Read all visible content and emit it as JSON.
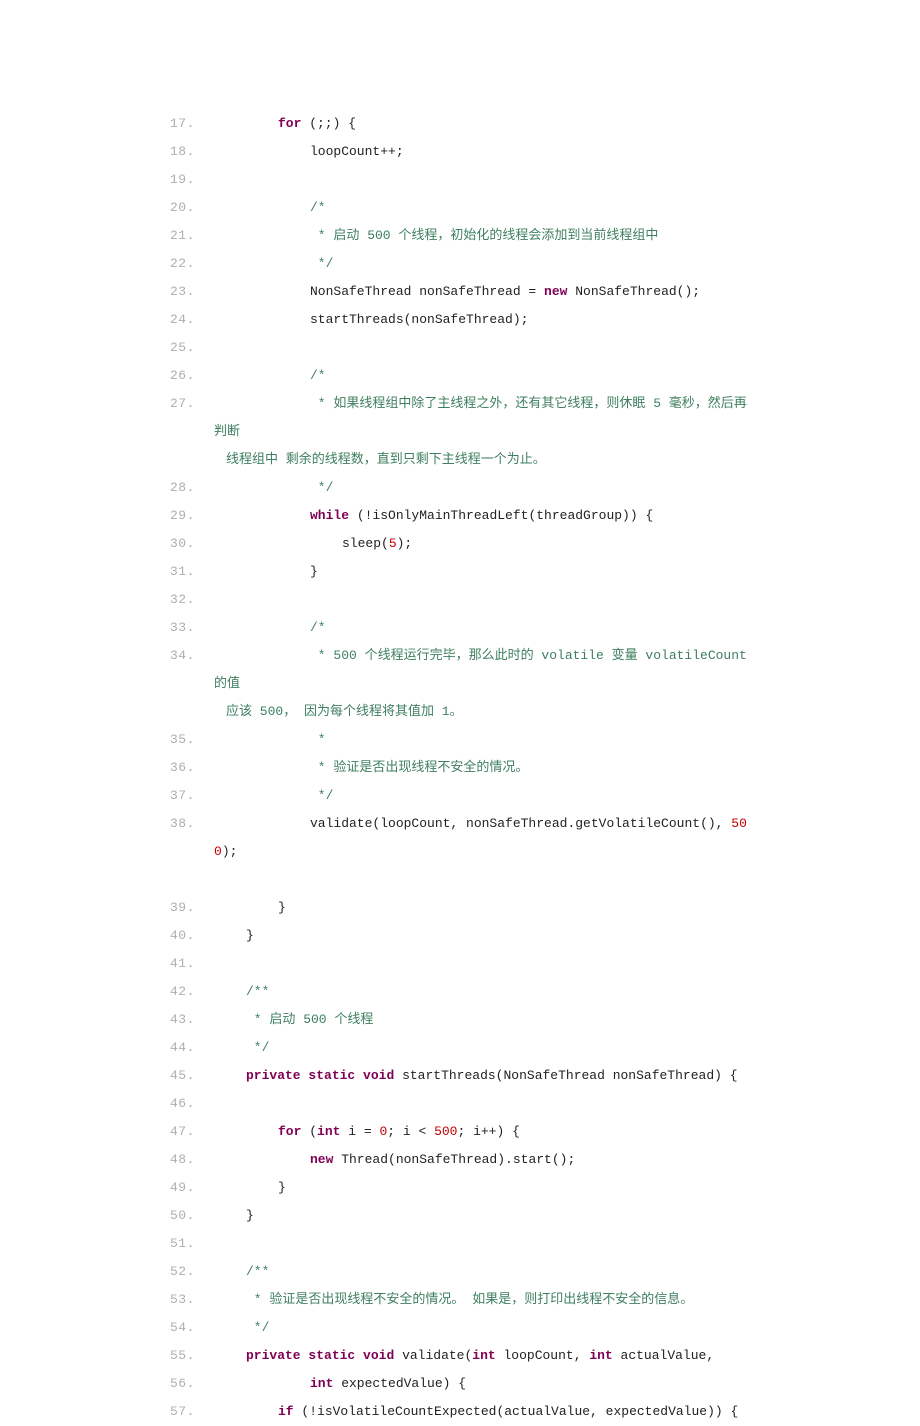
{
  "lines": [
    {
      "n": "17.",
      "segs": [
        {
          "cls": "ind8",
          "t": ""
        },
        {
          "cls": "kw",
          "t": "for"
        },
        {
          "cls": "plain",
          "t": " (;;) {"
        }
      ]
    },
    {
      "n": "18.",
      "segs": [
        {
          "cls": "ind12",
          "t": ""
        },
        {
          "cls": "plain",
          "t": "loopCount++;"
        }
      ]
    },
    {
      "n": "19.",
      "segs": [
        {
          "cls": "plain",
          "t": ""
        }
      ]
    },
    {
      "n": "20.",
      "segs": [
        {
          "cls": "ind12",
          "t": ""
        },
        {
          "cls": "com",
          "t": "/*"
        }
      ]
    },
    {
      "n": "21.",
      "segs": [
        {
          "cls": "ind12",
          "t": ""
        },
        {
          "cls": "com",
          "t": " * 启动 500 个线程，初始化的线程会添加到当前线程组中"
        }
      ]
    },
    {
      "n": "22.",
      "segs": [
        {
          "cls": "ind12",
          "t": ""
        },
        {
          "cls": "com",
          "t": " */"
        }
      ]
    },
    {
      "n": "23.",
      "segs": [
        {
          "cls": "ind12",
          "t": ""
        },
        {
          "cls": "plain",
          "t": "NonSafeThread nonSafeThread = "
        },
        {
          "cls": "kw",
          "t": "new"
        },
        {
          "cls": "plain",
          "t": " NonSafeThread();"
        }
      ]
    },
    {
      "n": "24.",
      "segs": [
        {
          "cls": "ind12",
          "t": ""
        },
        {
          "cls": "plain",
          "t": "startThreads(nonSafeThread);"
        }
      ]
    },
    {
      "n": "25.",
      "segs": [
        {
          "cls": "plain",
          "t": ""
        }
      ]
    },
    {
      "n": "26.",
      "segs": [
        {
          "cls": "ind12",
          "t": ""
        },
        {
          "cls": "com",
          "t": "/*"
        }
      ]
    },
    {
      "n": "27.",
      "segs": [
        {
          "cls": "ind12",
          "t": ""
        },
        {
          "cls": "com",
          "t": " * 如果线程组中除了主线程之外，还有其它线程，则休眠 5 毫秒，然后再判断"
        }
      ],
      "wrap": {
        "cls": "com",
        "t": "线程组中 剩余的线程数，直到只剩下主线程一个为止。"
      }
    },
    {
      "n": "28.",
      "segs": [
        {
          "cls": "ind12",
          "t": ""
        },
        {
          "cls": "com",
          "t": " */"
        }
      ]
    },
    {
      "n": "29.",
      "segs": [
        {
          "cls": "ind12",
          "t": ""
        },
        {
          "cls": "kw",
          "t": "while"
        },
        {
          "cls": "plain",
          "t": " (!isOnlyMainThreadLeft(threadGroup)) {"
        }
      ]
    },
    {
      "n": "30.",
      "segs": [
        {
          "cls": "ind16",
          "t": ""
        },
        {
          "cls": "plain",
          "t": "sleep("
        },
        {
          "cls": "num",
          "t": "5"
        },
        {
          "cls": "plain",
          "t": ");"
        }
      ]
    },
    {
      "n": "31.",
      "segs": [
        {
          "cls": "ind12",
          "t": ""
        },
        {
          "cls": "plain",
          "t": "}"
        }
      ]
    },
    {
      "n": "32.",
      "segs": [
        {
          "cls": "plain",
          "t": ""
        }
      ]
    },
    {
      "n": "33.",
      "segs": [
        {
          "cls": "ind12",
          "t": ""
        },
        {
          "cls": "com",
          "t": "/*"
        }
      ]
    },
    {
      "n": "34.",
      "segs": [
        {
          "cls": "ind12",
          "t": ""
        },
        {
          "cls": "com",
          "t": " * 500 个线程运行完毕，那么此时的 volatile 变量 volatileCount 的值"
        }
      ],
      "wrap": {
        "cls": "com",
        "t": "应该 500， 因为每个线程将其值加 1。"
      }
    },
    {
      "n": "35.",
      "segs": [
        {
          "cls": "ind12",
          "t": ""
        },
        {
          "cls": "com",
          "t": " *"
        }
      ]
    },
    {
      "n": "36.",
      "segs": [
        {
          "cls": "ind12",
          "t": ""
        },
        {
          "cls": "com",
          "t": " * 验证是否出现线程不安全的情况。"
        }
      ]
    },
    {
      "n": "37.",
      "segs": [
        {
          "cls": "ind12",
          "t": ""
        },
        {
          "cls": "com",
          "t": " */"
        }
      ]
    },
    {
      "n": "38.",
      "segs": [
        {
          "cls": "ind12",
          "t": ""
        },
        {
          "cls": "plain",
          "t": "validate(loopCount, nonSafeThread.getVolatileCount(), "
        },
        {
          "cls": "num",
          "t": "500"
        },
        {
          "cls": "plain",
          "t": ");"
        }
      ],
      "extraBlank": true
    },
    {
      "n": "39.",
      "segs": [
        {
          "cls": "ind8",
          "t": ""
        },
        {
          "cls": "plain",
          "t": "}"
        }
      ]
    },
    {
      "n": "40.",
      "segs": [
        {
          "cls": "ind4",
          "t": ""
        },
        {
          "cls": "plain",
          "t": "}"
        }
      ]
    },
    {
      "n": "41.",
      "segs": [
        {
          "cls": "plain",
          "t": ""
        }
      ]
    },
    {
      "n": "42.",
      "segs": [
        {
          "cls": "ind4",
          "t": ""
        },
        {
          "cls": "com",
          "t": "/**"
        }
      ]
    },
    {
      "n": "43.",
      "segs": [
        {
          "cls": "ind4",
          "t": ""
        },
        {
          "cls": "com",
          "t": " * 启动 500 个线程"
        }
      ]
    },
    {
      "n": "44.",
      "segs": [
        {
          "cls": "ind4",
          "t": ""
        },
        {
          "cls": "com",
          "t": " */"
        }
      ]
    },
    {
      "n": "45.",
      "segs": [
        {
          "cls": "ind4",
          "t": ""
        },
        {
          "cls": "kw",
          "t": "private"
        },
        {
          "cls": "plain",
          "t": " "
        },
        {
          "cls": "kw",
          "t": "static"
        },
        {
          "cls": "plain",
          "t": " "
        },
        {
          "cls": "kw",
          "t": "void"
        },
        {
          "cls": "plain",
          "t": " startThreads(NonSafeThread nonSafeThread) {"
        }
      ]
    },
    {
      "n": "46.",
      "segs": [
        {
          "cls": "plain",
          "t": ""
        }
      ]
    },
    {
      "n": "47.",
      "segs": [
        {
          "cls": "ind8",
          "t": ""
        },
        {
          "cls": "kw",
          "t": "for"
        },
        {
          "cls": "plain",
          "t": " ("
        },
        {
          "cls": "kw",
          "t": "int"
        },
        {
          "cls": "plain",
          "t": " i = "
        },
        {
          "cls": "num",
          "t": "0"
        },
        {
          "cls": "plain",
          "t": "; i < "
        },
        {
          "cls": "num",
          "t": "500"
        },
        {
          "cls": "plain",
          "t": "; i++) {"
        }
      ]
    },
    {
      "n": "48.",
      "segs": [
        {
          "cls": "ind12",
          "t": ""
        },
        {
          "cls": "kw",
          "t": "new"
        },
        {
          "cls": "plain",
          "t": " Thread(nonSafeThread).start();"
        }
      ]
    },
    {
      "n": "49.",
      "segs": [
        {
          "cls": "ind8",
          "t": ""
        },
        {
          "cls": "plain",
          "t": "}"
        }
      ]
    },
    {
      "n": "50.",
      "segs": [
        {
          "cls": "ind4",
          "t": ""
        },
        {
          "cls": "plain",
          "t": "}"
        }
      ]
    },
    {
      "n": "51.",
      "segs": [
        {
          "cls": "plain",
          "t": ""
        }
      ]
    },
    {
      "n": "52.",
      "segs": [
        {
          "cls": "ind4",
          "t": ""
        },
        {
          "cls": "com",
          "t": "/**"
        }
      ]
    },
    {
      "n": "53.",
      "segs": [
        {
          "cls": "ind4",
          "t": ""
        },
        {
          "cls": "com",
          "t": " * 验证是否出现线程不安全的情况。 如果是，则打印出线程不安全的信息。"
        }
      ]
    },
    {
      "n": "54.",
      "segs": [
        {
          "cls": "ind4",
          "t": ""
        },
        {
          "cls": "com",
          "t": " */"
        }
      ]
    },
    {
      "n": "55.",
      "segs": [
        {
          "cls": "ind4",
          "t": ""
        },
        {
          "cls": "kw",
          "t": "private"
        },
        {
          "cls": "plain",
          "t": " "
        },
        {
          "cls": "kw",
          "t": "static"
        },
        {
          "cls": "plain",
          "t": " "
        },
        {
          "cls": "kw",
          "t": "void"
        },
        {
          "cls": "plain",
          "t": " validate("
        },
        {
          "cls": "kw",
          "t": "int"
        },
        {
          "cls": "plain",
          "t": " loopCount, "
        },
        {
          "cls": "kw",
          "t": "int"
        },
        {
          "cls": "plain",
          "t": " actualValue,"
        }
      ]
    },
    {
      "n": "56.",
      "segs": [
        {
          "cls": "ind12",
          "t": ""
        },
        {
          "cls": "kw",
          "t": "int"
        },
        {
          "cls": "plain",
          "t": " expectedValue) {"
        }
      ]
    },
    {
      "n": "57.",
      "segs": [
        {
          "cls": "ind8",
          "t": ""
        },
        {
          "cls": "kw",
          "t": "if"
        },
        {
          "cls": "plain",
          "t": " (!isVolatileCountExpected(actualValue, expectedValue)) {"
        }
      ]
    }
  ]
}
